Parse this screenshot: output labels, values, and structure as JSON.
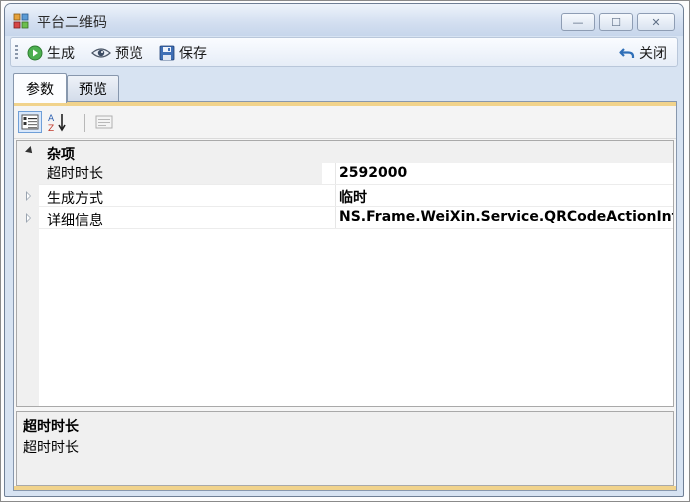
{
  "window": {
    "title": "平台二维码",
    "controls": {
      "minimize": "—",
      "maximize": "☐",
      "close": "✕"
    }
  },
  "toolbar": {
    "generate_label": "生成",
    "preview_label": "预览",
    "save_label": "保存",
    "close_label": "关闭"
  },
  "tabs": [
    {
      "label": "参数",
      "active": true
    },
    {
      "label": "预览",
      "active": false
    }
  ],
  "property_grid": {
    "toolbar": {
      "categorized_icon": "categorized-icon",
      "alphabetical_icon": "sort-alpha-icon",
      "property_pages_icon": "property-pages-icon"
    },
    "category": "杂项",
    "rows": [
      {
        "name": "超时时长",
        "value": "2592000",
        "expandable": false,
        "selected": true
      },
      {
        "name": "生成方式",
        "value": "临时",
        "expandable": true,
        "selected": false
      },
      {
        "name": "详细信息",
        "value": "NS.Frame.WeiXin.Service.QRCodeActionInfo",
        "expandable": true,
        "selected": false
      }
    ],
    "help": {
      "title": "超时时长",
      "description": "超时时长"
    }
  },
  "colors": {
    "accent_orange": "#f1d38c",
    "window_frame": "#d7e3f2"
  }
}
